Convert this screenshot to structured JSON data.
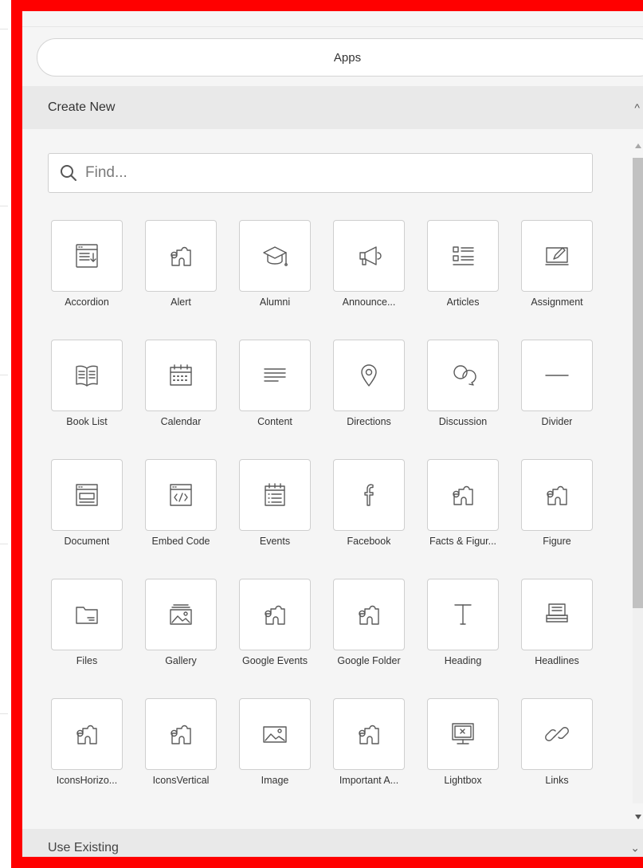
{
  "header": {
    "apps_label": "Apps"
  },
  "create_new": {
    "title": "Create New",
    "search_placeholder": "Find...",
    "items": [
      {
        "label": "Accordion",
        "icon": "accordion-icon"
      },
      {
        "label": "Alert",
        "icon": "puzzle-icon"
      },
      {
        "label": "Alumni",
        "icon": "graduation-cap-icon"
      },
      {
        "label": "Announce...",
        "icon": "megaphone-icon"
      },
      {
        "label": "Articles",
        "icon": "articles-list-icon"
      },
      {
        "label": "Assignment",
        "icon": "assignment-pencil-icon"
      },
      {
        "label": "Book List",
        "icon": "open-book-icon"
      },
      {
        "label": "Calendar",
        "icon": "calendar-icon"
      },
      {
        "label": "Content",
        "icon": "text-lines-icon"
      },
      {
        "label": "Directions",
        "icon": "map-pin-icon"
      },
      {
        "label": "Discussion",
        "icon": "speech-bubbles-icon"
      },
      {
        "label": "Divider",
        "icon": "divider-line-icon"
      },
      {
        "label": "Document",
        "icon": "document-window-icon"
      },
      {
        "label": "Embed Code",
        "icon": "embed-code-icon"
      },
      {
        "label": "Events",
        "icon": "events-calendar-icon"
      },
      {
        "label": "Facebook",
        "icon": "facebook-icon"
      },
      {
        "label": "Facts & Figur...",
        "icon": "puzzle-icon"
      },
      {
        "label": "Figure",
        "icon": "puzzle-icon"
      },
      {
        "label": "Files",
        "icon": "folder-icon"
      },
      {
        "label": "Gallery",
        "icon": "gallery-icon"
      },
      {
        "label": "Google Events",
        "icon": "puzzle-icon"
      },
      {
        "label": "Google Folder",
        "icon": "puzzle-icon"
      },
      {
        "label": "Heading",
        "icon": "text-cursor-icon"
      },
      {
        "label": "Headlines",
        "icon": "headlines-stack-icon"
      },
      {
        "label": "IconsHorizo...",
        "icon": "puzzle-icon"
      },
      {
        "label": "IconsVertical",
        "icon": "puzzle-icon"
      },
      {
        "label": "Image",
        "icon": "image-icon"
      },
      {
        "label": "Important A...",
        "icon": "puzzle-icon"
      },
      {
        "label": "Lightbox",
        "icon": "lightbox-monitor-icon"
      },
      {
        "label": "Links",
        "icon": "chain-link-icon"
      }
    ]
  },
  "use_existing": {
    "title": "Use Existing"
  }
}
